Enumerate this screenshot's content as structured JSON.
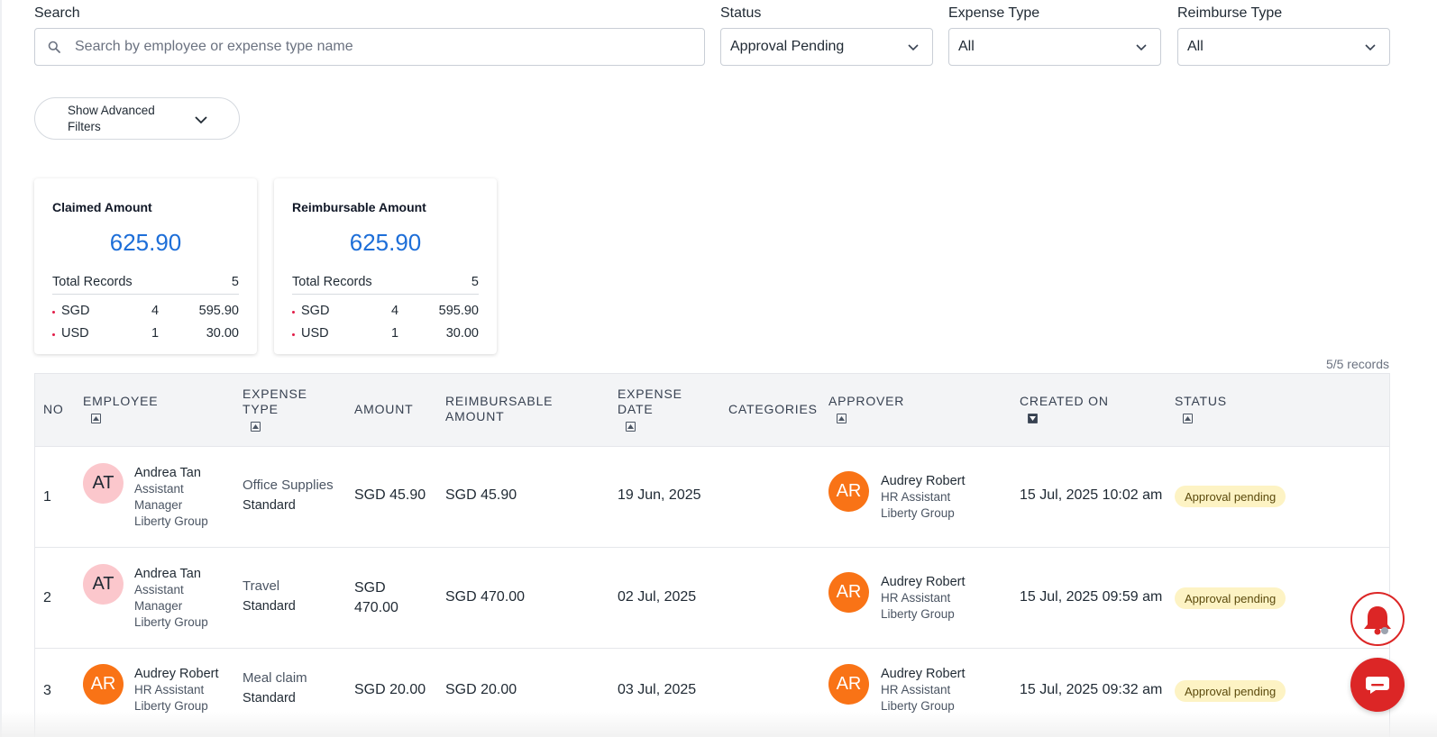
{
  "filters": {
    "search_label": "Search",
    "search_placeholder": "Search by employee or expense type name",
    "status_label": "Status",
    "status_value": "Approval Pending",
    "expense_type_label": "Expense Type",
    "expense_type_value": "All",
    "reimburse_type_label": "Reimburse Type",
    "reimburse_type_value": "All",
    "advanced_label": "Show Advanced Filters"
  },
  "summary": [
    {
      "title": "Claimed Amount",
      "amount": "625.90",
      "total_label": "Total Records",
      "total_value": "5",
      "currencies": [
        {
          "code": "SGD",
          "count": "4",
          "amount": "595.90"
        },
        {
          "code": "USD",
          "count": "1",
          "amount": "30.00"
        }
      ]
    },
    {
      "title": "Reimbursable Amount",
      "amount": "625.90",
      "total_label": "Total Records",
      "total_value": "5",
      "currencies": [
        {
          "code": "SGD",
          "count": "4",
          "amount": "595.90"
        },
        {
          "code": "USD",
          "count": "1",
          "amount": "30.00"
        }
      ]
    }
  ],
  "records_count": "5/5 records",
  "table": {
    "headers": {
      "no": "NO",
      "employee": "EMPLOYEE",
      "expense_type_1": "EXPENSE",
      "expense_type_2": "TYPE",
      "amount": "AMOUNT",
      "reimbursable_1": "REIMBURSABLE",
      "reimbursable_2": "AMOUNT",
      "expense_date_1": "EXPENSE",
      "expense_date_2": "DATE",
      "categories": "CATEGORIES",
      "approver": "APPROVER",
      "created_on": "CREATED ON",
      "status": "STATUS"
    },
    "rows": [
      {
        "no": "1",
        "emp_initials": "AT",
        "emp_name": "Andrea Tan",
        "emp_role_1": "Assistant",
        "emp_role_2": "Manager",
        "emp_company": "Liberty Group",
        "type_name": "Office Supplies",
        "type_sub": "Standard",
        "amount_1": "SGD 45.90",
        "amount_2": "",
        "reimbursable": "SGD 45.90",
        "expense_date": "19 Jun, 2025",
        "appr_initials": "AR",
        "appr_name": "Audrey Robert",
        "appr_role": "HR Assistant",
        "appr_company": "Liberty Group",
        "created_on": "15 Jul, 2025 10:02 am",
        "status": "Approval pending"
      },
      {
        "no": "2",
        "emp_initials": "AT",
        "emp_name": "Andrea Tan",
        "emp_role_1": "Assistant",
        "emp_role_2": "Manager",
        "emp_company": "Liberty Group",
        "type_name": "Travel",
        "type_sub": "Standard",
        "amount_1": "SGD",
        "amount_2": "470.00",
        "reimbursable": "SGD 470.00",
        "expense_date": "02 Jul, 2025",
        "appr_initials": "AR",
        "appr_name": "Audrey Robert",
        "appr_role": "HR Assistant",
        "appr_company": "Liberty Group",
        "created_on": "15 Jul, 2025 09:59 am",
        "status": "Approval pending"
      },
      {
        "no": "3",
        "emp_initials": "AR",
        "emp_name": "Audrey Robert",
        "emp_role_1": "HR Assistant",
        "emp_role_2": "",
        "emp_company": "Liberty Group",
        "type_name": "Meal claim",
        "type_sub": "Standard",
        "amount_1": "SGD 20.00",
        "amount_2": "",
        "reimbursable": "SGD 20.00",
        "expense_date": "03 Jul, 2025",
        "appr_initials": "AR",
        "appr_name": "Audrey Robert",
        "appr_role": "HR Assistant",
        "appr_company": "Liberty Group",
        "created_on": "15 Jul, 2025 09:32 am",
        "status": "Approval pending"
      }
    ]
  },
  "floating": {
    "bell_icon": "bell-icon",
    "chat_icon": "chat-icon"
  }
}
